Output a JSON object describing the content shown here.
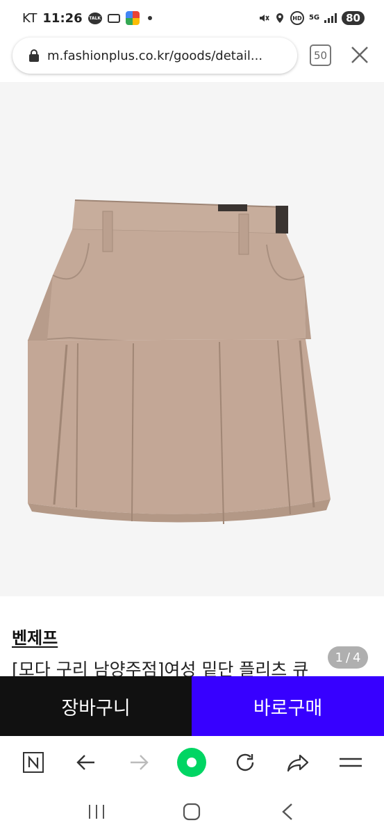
{
  "status_bar": {
    "carrier": "KT",
    "time": "11:26",
    "talk_icon_text": "TALK",
    "network": "5G",
    "hd_label": "HD",
    "battery": "80"
  },
  "browser": {
    "url": "m.fashionplus.co.kr/goods/detail...",
    "tab_count": "50"
  },
  "product": {
    "image_index": "1",
    "image_total": "4",
    "brand": "벤제프",
    "title": "[모다 구리 남양주점]여성 밑단 플리츠 큐"
  },
  "actions": {
    "cart_label": "장바구니",
    "buy_label": "바로구매"
  },
  "colors": {
    "buy_button": "#3700ff",
    "cart_button": "#111111",
    "skirt": "#c4a998",
    "home_button": "#00d563"
  },
  "toolbar_icons": [
    "naver-n-icon",
    "back-arrow-icon",
    "forward-arrow-icon",
    "home-green-icon",
    "refresh-icon",
    "share-icon",
    "menu-icon"
  ],
  "nav_icons": [
    "recent-apps-icon",
    "home-icon",
    "back-icon"
  ]
}
